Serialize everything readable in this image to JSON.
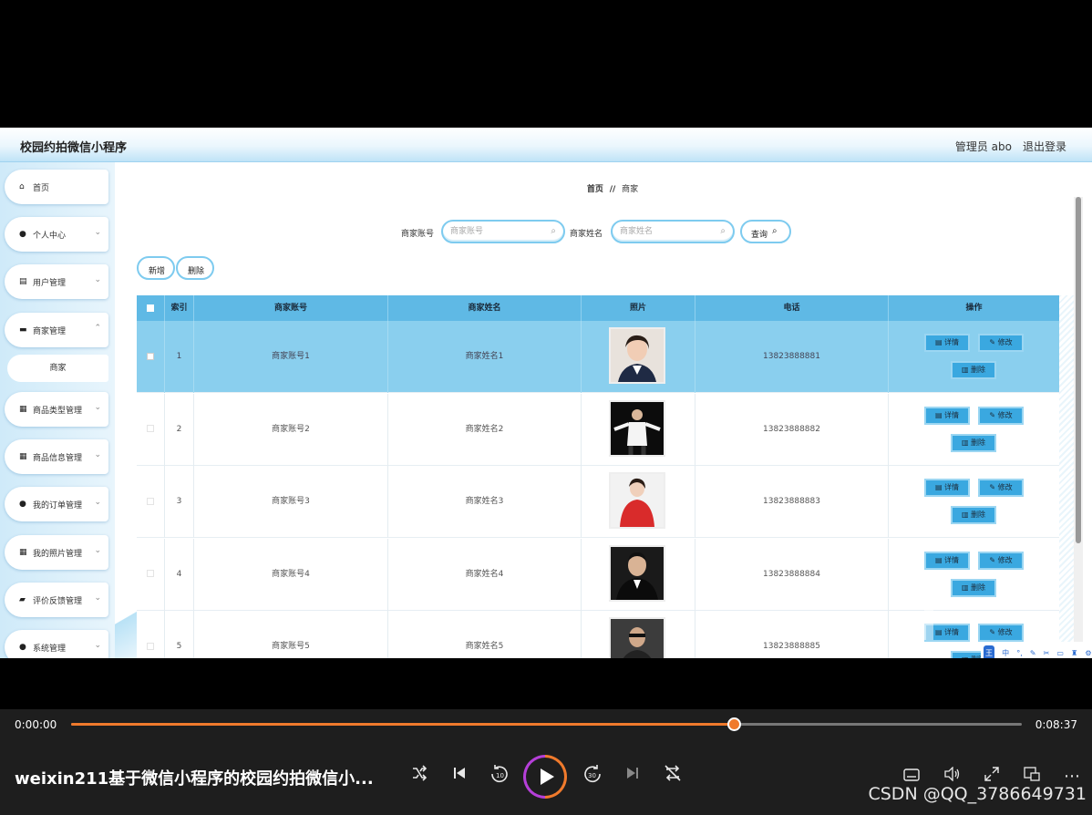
{
  "app": {
    "title": "校园约拍微信小程序",
    "user_label": "管理员 abo",
    "logout_label": "退出登录"
  },
  "sidebar": {
    "items": [
      {
        "label": "首页",
        "icon": "home-icon"
      },
      {
        "label": "个人中心",
        "icon": "person-icon"
      },
      {
        "label": "用户管理",
        "icon": "clipboard-icon"
      },
      {
        "label": "商家管理",
        "icon": "briefcase-icon"
      },
      {
        "label": "商品类型管理",
        "icon": "grid-icon"
      },
      {
        "label": "商品信息管理",
        "icon": "grid-icon"
      },
      {
        "label": "我的订单管理",
        "icon": "person-icon"
      },
      {
        "label": "我的照片管理",
        "icon": "grid-icon"
      },
      {
        "label": "评价反馈管理",
        "icon": "folder-icon"
      },
      {
        "label": "系统管理",
        "icon": "person-icon"
      }
    ],
    "submenu": {
      "label": "商家"
    }
  },
  "breadcrumb": {
    "home": "首页",
    "separator": "//",
    "current": "商家"
  },
  "search": {
    "account_label": "商家账号",
    "account_placeholder": "商家账号",
    "name_label": "商家姓名",
    "name_placeholder": "商家姓名",
    "query_label": "查询"
  },
  "actions": {
    "add_label": "新增",
    "delete_label": "删除"
  },
  "table": {
    "headers": {
      "index": "索引",
      "account": "商家账号",
      "name": "商家姓名",
      "photo": "照片",
      "phone": "电话",
      "ops": "操作"
    },
    "op_labels": {
      "detail": "详情",
      "edit": "修改",
      "delete": "删除"
    },
    "rows": [
      {
        "index": "1",
        "account": "商家账号1",
        "name": "商家姓名1",
        "phone": "13823888881"
      },
      {
        "index": "2",
        "account": "商家账号2",
        "name": "商家姓名2",
        "phone": "13823888882"
      },
      {
        "index": "3",
        "account": "商家账号3",
        "name": "商家姓名3",
        "phone": "13823888883"
      },
      {
        "index": "4",
        "account": "商家账号4",
        "name": "商家姓名4",
        "phone": "13823888884"
      },
      {
        "index": "5",
        "account": "商家账号5",
        "name": "商家姓名5",
        "phone": "13823888885"
      }
    ]
  },
  "ime": {
    "label": "中"
  },
  "player": {
    "time_current": "0:00:00",
    "time_total": "0:08:37",
    "progress": 0.697,
    "video_title": "weixin211基于微信小程序的校园约拍微信小...",
    "watermark": "CSDN @QQ_3786649731",
    "accent_color": "#f07a2c"
  }
}
